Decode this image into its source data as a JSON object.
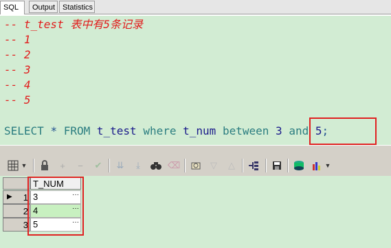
{
  "tabs": [
    {
      "label": "SQL"
    },
    {
      "label": "Output"
    },
    {
      "label": "Statistics"
    }
  ],
  "editor": {
    "comment_lines": [
      "-- t_test 表中有5条记录",
      "-- 1",
      "-- 2",
      "-- 3",
      "-- 4",
      "-- 5"
    ],
    "sql": {
      "select": "SELECT",
      "star": "*",
      "from": "FROM",
      "table": "t_test",
      "where": "where",
      "column": "t_num",
      "between": "between",
      "low": "3",
      "and": "and",
      "high": "5",
      "semicolon": ";"
    }
  },
  "grid": {
    "column_header": "T_NUM",
    "rows": [
      {
        "row_num": "1",
        "value": "3"
      },
      {
        "row_num": "2",
        "value": "4"
      },
      {
        "row_num": "3",
        "value": "5"
      }
    ],
    "ellipsis": "···"
  },
  "colors": {
    "editor_bg": "#d2ecd3",
    "comment": "#e11c1c",
    "highlight_box": "#e02020"
  }
}
